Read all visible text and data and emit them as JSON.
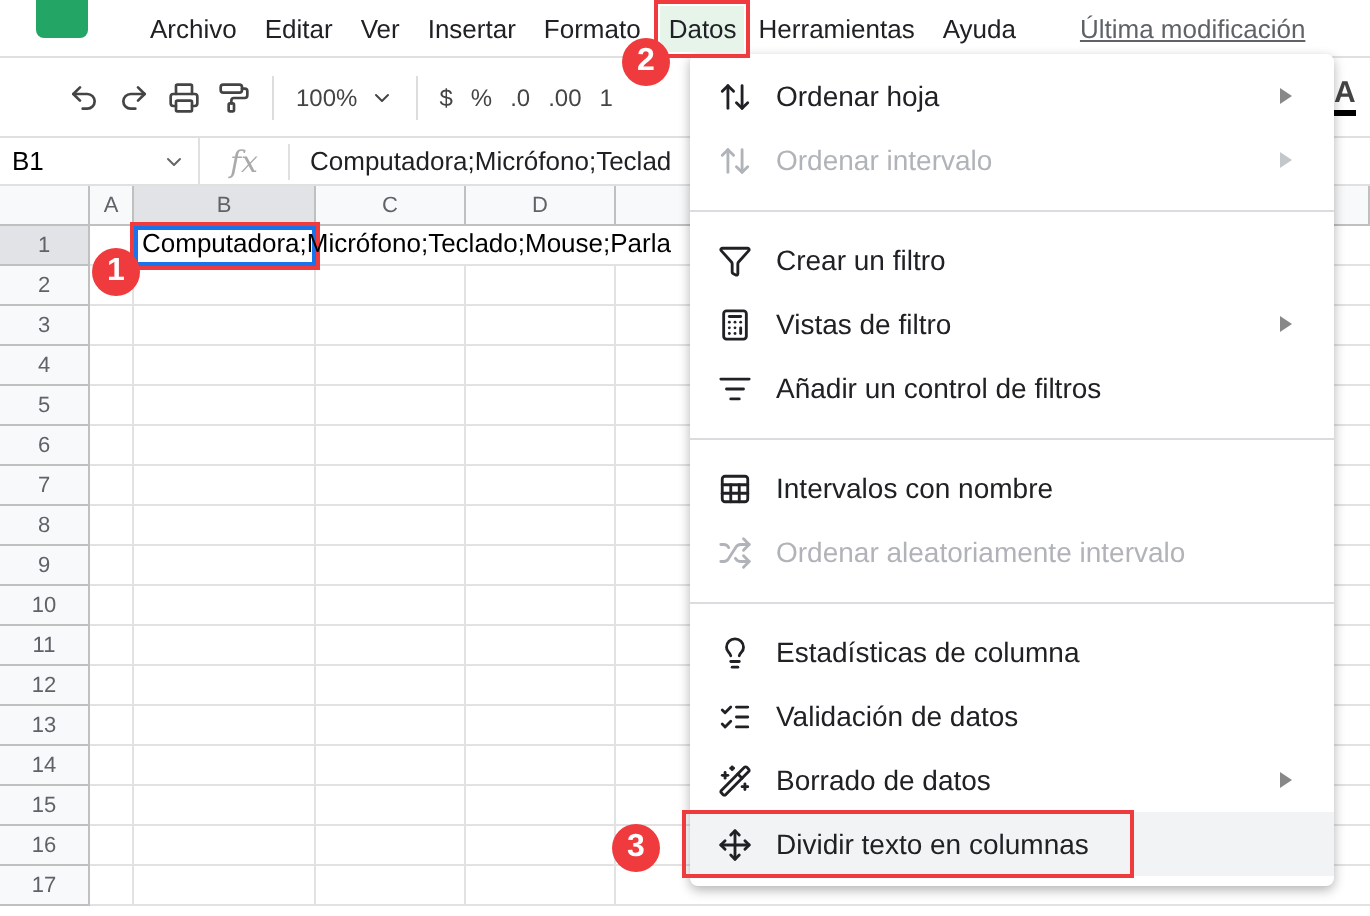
{
  "menu_bar": [
    {
      "label": "Archivo",
      "selected": false
    },
    {
      "label": "Editar",
      "selected": false
    },
    {
      "label": "Ver",
      "selected": false
    },
    {
      "label": "Insertar",
      "selected": false
    },
    {
      "label": "Formato",
      "selected": false
    },
    {
      "label": "Datos",
      "selected": true
    },
    {
      "label": "Herramientas",
      "selected": false
    },
    {
      "label": "Ayuda",
      "selected": false
    }
  ],
  "last_edit": "Última modificación",
  "toolbar": {
    "zoom": "100%",
    "currency": "$",
    "percent": "%",
    "decrease_decimals": ".0",
    "increase_decimals": ".00",
    "more_formats": "1",
    "text_color": "A"
  },
  "formula_bar": {
    "cell_ref": "B1",
    "fx": "fx",
    "value": "Computadora;Micrófono;Teclad"
  },
  "grid": {
    "columns": [
      {
        "label": "A",
        "selected": false
      },
      {
        "label": "B",
        "selected": true
      },
      {
        "label": "C",
        "selected": false
      },
      {
        "label": "D",
        "selected": false
      }
    ],
    "rows": [
      {
        "label": "1",
        "selected": true
      },
      {
        "label": "2",
        "selected": false
      },
      {
        "label": "3",
        "selected": false
      },
      {
        "label": "4",
        "selected": false
      },
      {
        "label": "5",
        "selected": false
      },
      {
        "label": "6",
        "selected": false
      },
      {
        "label": "7",
        "selected": false
      },
      {
        "label": "8",
        "selected": false
      },
      {
        "label": "9",
        "selected": false
      },
      {
        "label": "10",
        "selected": false
      },
      {
        "label": "11",
        "selected": false
      },
      {
        "label": "12",
        "selected": false
      },
      {
        "label": "13",
        "selected": false
      },
      {
        "label": "14",
        "selected": false
      },
      {
        "label": "15",
        "selected": false
      },
      {
        "label": "16",
        "selected": false
      },
      {
        "label": "17",
        "selected": false
      }
    ],
    "active_cell_text": "Computadora;Micrófono;Teclado;Mouse;Parla"
  },
  "menu": [
    {
      "kind": "item",
      "label": "Ordenar hoja",
      "disabled": false,
      "submenu": true,
      "selected": false
    },
    {
      "kind": "item",
      "label": "Ordenar intervalo",
      "disabled": true,
      "submenu": true,
      "selected": false
    },
    {
      "kind": "separator"
    },
    {
      "kind": "item",
      "label": "Crear un filtro",
      "disabled": false,
      "submenu": false,
      "selected": false
    },
    {
      "kind": "item",
      "label": "Vistas de filtro",
      "disabled": false,
      "submenu": true,
      "selected": false
    },
    {
      "kind": "item",
      "label": "Añadir un control de filtros",
      "disabled": false,
      "submenu": false,
      "selected": false
    },
    {
      "kind": "separator"
    },
    {
      "kind": "item",
      "label": "Intervalos con nombre",
      "disabled": false,
      "submenu": false,
      "selected": false
    },
    {
      "kind": "item",
      "label": "Ordenar aleatoriamente intervalo",
      "disabled": true,
      "submenu": false,
      "selected": false
    },
    {
      "kind": "separator"
    },
    {
      "kind": "item",
      "label": "Estadísticas de columna",
      "disabled": false,
      "submenu": false,
      "selected": false
    },
    {
      "kind": "item",
      "label": "Validación de datos",
      "disabled": false,
      "submenu": false,
      "selected": false
    },
    {
      "kind": "item",
      "label": "Borrado de datos",
      "disabled": false,
      "submenu": true,
      "selected": false
    },
    {
      "kind": "item",
      "label": "Dividir texto en columnas",
      "disabled": false,
      "submenu": false,
      "selected": true
    }
  ],
  "callouts": [
    "1",
    "2",
    "3"
  ]
}
